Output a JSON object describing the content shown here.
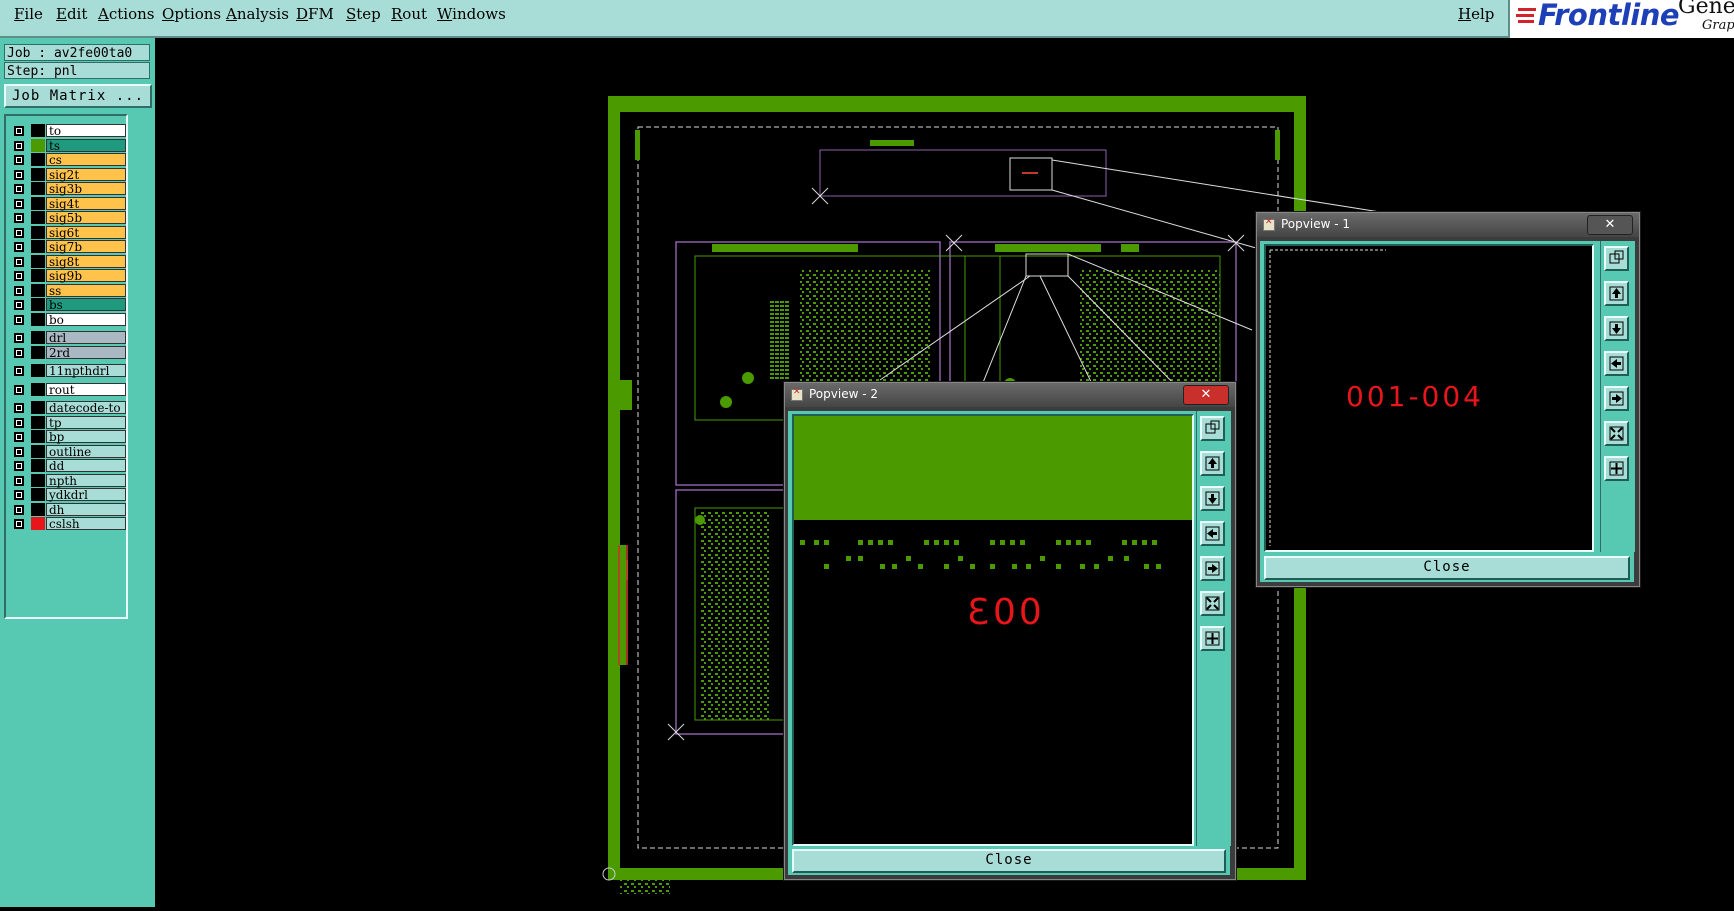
{
  "menu": {
    "items": [
      "File",
      "Edit",
      "Actions",
      "Options",
      "Analysis",
      "DFM",
      "Step",
      "Rout",
      "Windows"
    ],
    "help": "Help"
  },
  "logo": {
    "brand": "Frontline",
    "product_partial": "Gene",
    "subtitle_partial": "Graph"
  },
  "job": {
    "job_text": "Job : av2fe00ta0",
    "step_text": "Step: pnl",
    "matrix_button": "Job Matrix ..."
  },
  "layers": [
    {
      "name": "to",
      "fill": "#ffffff",
      "swatch": "#000000"
    },
    {
      "name": "ts",
      "fill": "#1f9a7e",
      "swatch": "#4a9a00"
    },
    {
      "name": "cs",
      "fill": "#ffc24a",
      "swatch": "#000000"
    },
    {
      "name": "sig2t",
      "fill": "#ffc24a",
      "swatch": "#000000"
    },
    {
      "name": "sig3b",
      "fill": "#ffc24a",
      "swatch": "#000000"
    },
    {
      "name": "sig4t",
      "fill": "#ffc24a",
      "swatch": "#000000"
    },
    {
      "name": "sig5b",
      "fill": "#ffc24a",
      "swatch": "#000000"
    },
    {
      "name": "sig6t",
      "fill": "#ffc24a",
      "swatch": "#000000"
    },
    {
      "name": "sig7b",
      "fill": "#ffc24a",
      "swatch": "#000000"
    },
    {
      "name": "sig8t",
      "fill": "#ffc24a",
      "swatch": "#000000"
    },
    {
      "name": "sig9b",
      "fill": "#ffc24a",
      "swatch": "#000000"
    },
    {
      "name": "ss",
      "fill": "#ffc24a",
      "swatch": "#000000"
    },
    {
      "name": "bs",
      "fill": "#1f9a7e",
      "swatch": "#000000"
    },
    {
      "name": "bo",
      "fill": "#ffffff",
      "swatch": "#000000"
    },
    {
      "name": "drl",
      "fill": "#a9b8c2",
      "swatch": "#000000"
    },
    {
      "name": "2rd",
      "fill": "#a9b8c2",
      "swatch": "#000000"
    },
    {
      "name": "11npthdrl",
      "fill": "#a8dcd6",
      "swatch": "#000000"
    },
    {
      "name": "rout",
      "fill": "#ffffff",
      "swatch": "#000000"
    },
    {
      "name": "datecode-to",
      "fill": "#a8dcd6",
      "swatch": "#000000"
    },
    {
      "name": "tp",
      "fill": "#a8dcd6",
      "swatch": "#000000"
    },
    {
      "name": "bp",
      "fill": "#a8dcd6",
      "swatch": "#000000"
    },
    {
      "name": "outline",
      "fill": "#a8dcd6",
      "swatch": "#000000"
    },
    {
      "name": "dd",
      "fill": "#a8dcd6",
      "swatch": "#000000"
    },
    {
      "name": "npth",
      "fill": "#a8dcd6",
      "swatch": "#000000"
    },
    {
      "name": "ydkdrl",
      "fill": "#a8dcd6",
      "swatch": "#000000"
    },
    {
      "name": "dh",
      "fill": "#a8dcd6",
      "swatch": "#000000"
    },
    {
      "name": "cslsh",
      "fill": "#a8dcd6",
      "swatch": "#e8161b"
    }
  ],
  "popview1": {
    "title": "Popview - 1",
    "close_x": "✕",
    "close_label": "Close",
    "label": "001-004"
  },
  "popview2": {
    "title": "Popview - 2",
    "close_x": "✕",
    "close_label": "Close",
    "label": "003"
  },
  "colors": {
    "board_green": "#4a9a00",
    "accent": "#57c9b2",
    "panel_light": "#a8dcd6",
    "label_red": "#e8161b"
  }
}
